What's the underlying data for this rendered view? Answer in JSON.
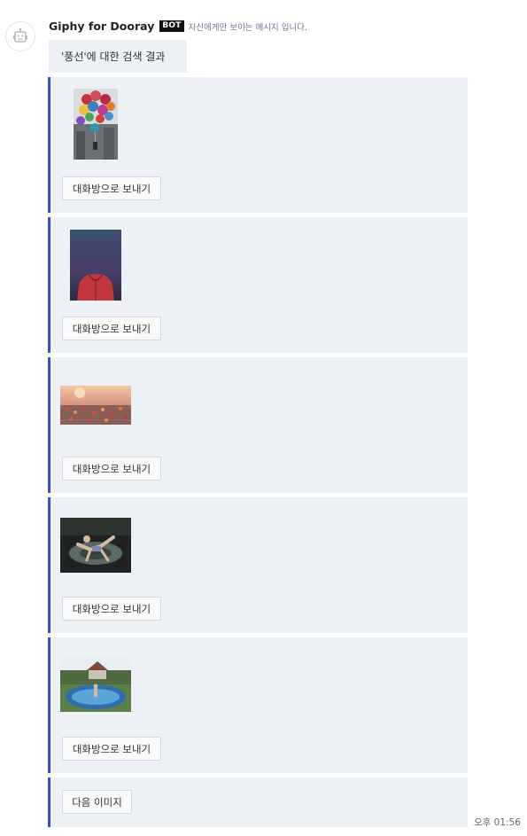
{
  "message": {
    "sender": "Giphy for Dooray",
    "badge": "BOT",
    "visibility_note": "자신에게만 보이는 메시지 입니다.",
    "result_title": "'풍선'에 대한 검색 결과",
    "timestamp": "오후 01:56"
  },
  "results": [
    {
      "button_label": "대화방으로 보내기",
      "image": "balloons-over-city-gif"
    },
    {
      "button_label": "대화방으로 보내기",
      "image": "red-hoodie-gif"
    },
    {
      "button_label": "대화방으로 보내기",
      "image": "balloons-over-crowd-gif"
    },
    {
      "button_label": "대화방으로 보내기",
      "image": "person-on-inflatable-gif"
    },
    {
      "button_label": "대화방으로 보내기",
      "image": "pool-in-yard-gif"
    }
  ],
  "pagination": {
    "next_label": "다음 이미지"
  },
  "colors": {
    "accent": "#3a4ec9",
    "card_bg": "#edf0f5"
  }
}
